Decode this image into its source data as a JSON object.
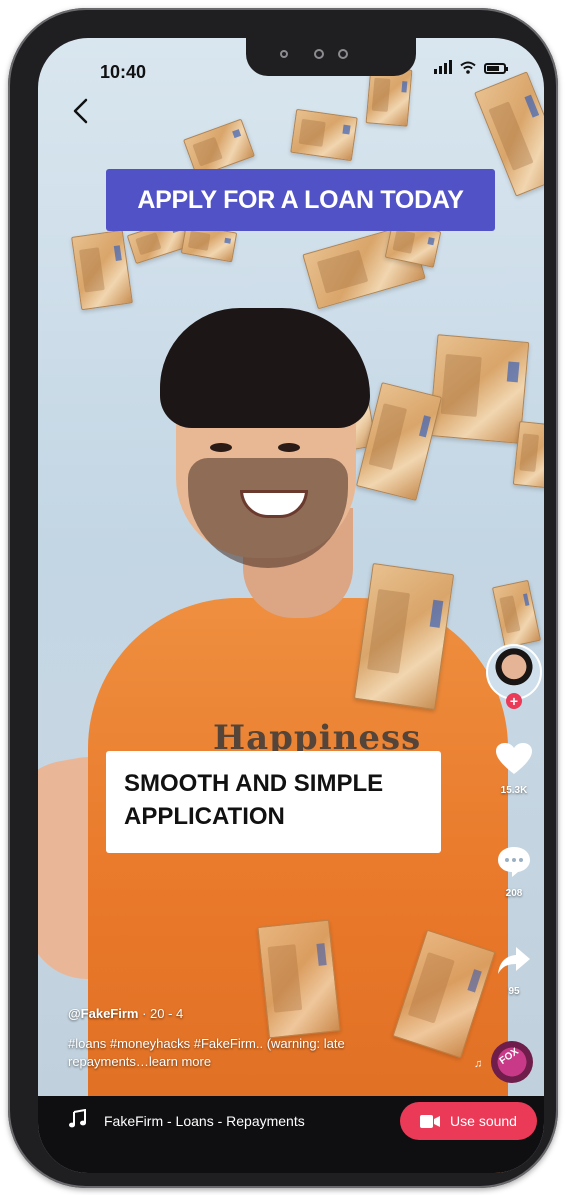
{
  "status_bar": {
    "time": "10:40"
  },
  "banners": {
    "top": "APPLY FOR A LOAN TODAY",
    "middle_line1": "SMOOTH AND SIMPLE",
    "middle_line2": "APPLICATION"
  },
  "video": {
    "shirt_text": "Happiness"
  },
  "actions": {
    "likes": "15.3K",
    "comments": "208",
    "shares": "95"
  },
  "caption": {
    "username": "@FakeFirm",
    "meta": " · 20 - 4",
    "text": "#loans #moneyhacks #FakeFirm.. (warning: late repayments…learn more"
  },
  "music": {
    "disc_label": "FOX",
    "sound_name": "FakeFirm - Loans - Repayments",
    "use_sound_label": "Use sound"
  },
  "colors": {
    "accent": "#ea3a57",
    "banner": "#5252c7",
    "bar": "#0f0f12"
  },
  "icons": [
    "back-icon",
    "signal-icon",
    "wifi-icon",
    "battery-icon",
    "heart-icon",
    "comment-icon",
    "share-icon",
    "music-note-icon",
    "video-camera-icon"
  ]
}
